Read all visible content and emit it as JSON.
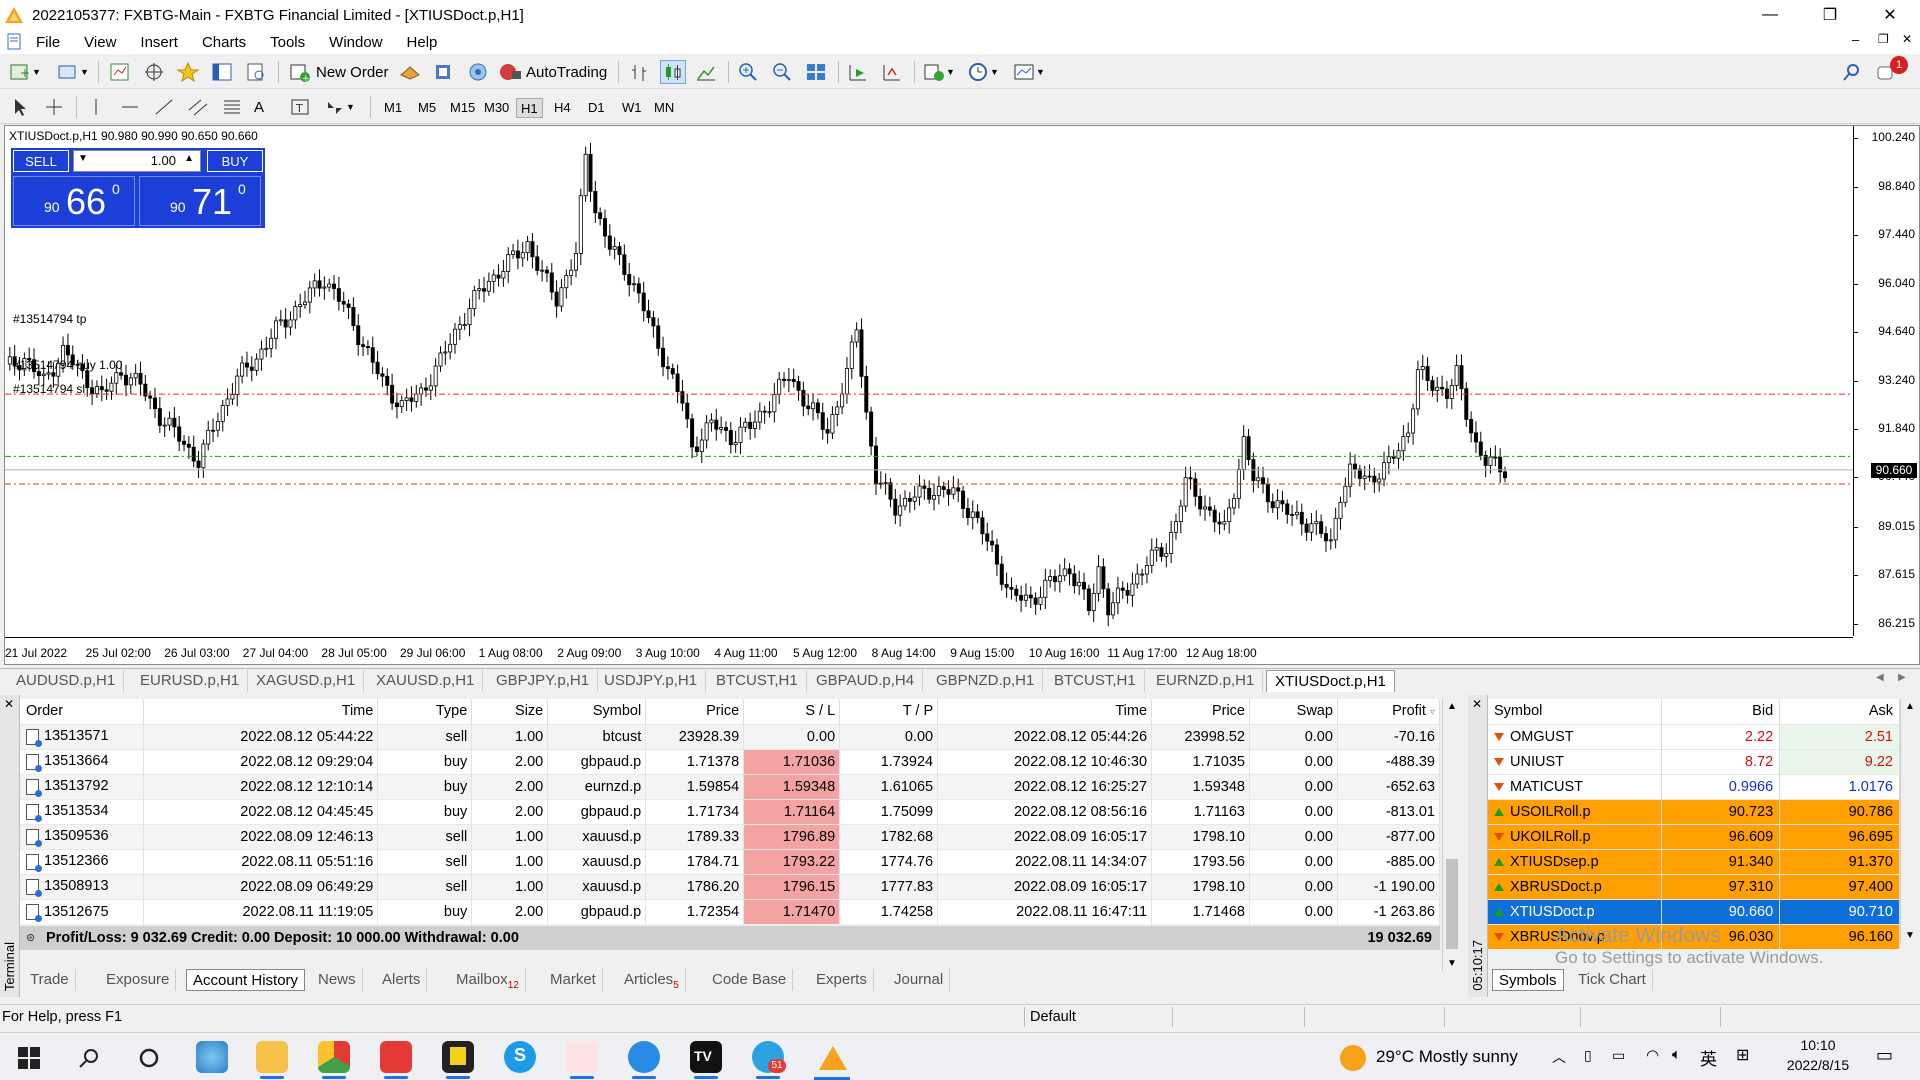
{
  "window": {
    "title": "2022105377: FXBTG-Main - FXBTG Financial Limited - [XTIUSDoct.p,H1]",
    "minimize": "—",
    "maximize": "❐",
    "close": "✕"
  },
  "menu": [
    "File",
    "View",
    "Insert",
    "Charts",
    "Tools",
    "Window",
    "Help"
  ],
  "toolbar": {
    "new_order": "New Order",
    "autotrading": "AutoTrading",
    "notification_count": "1"
  },
  "timeframes": [
    "M1",
    "M5",
    "M15",
    "M30",
    "H1",
    "H4",
    "D1",
    "W1",
    "MN"
  ],
  "active_timeframe": "H1",
  "chart": {
    "caption": "XTIUSDoct.p,H1  90.980 90.990 90.650 90.660",
    "sell_label": "SELL",
    "buy_label": "BUY",
    "volume": "1.00",
    "sell_small": "90",
    "sell_big": "66",
    "sell_sup": "0",
    "buy_small": "90",
    "buy_big": "71",
    "buy_sup": "0",
    "current_price": "90.660",
    "order_labels": [
      "#13514794 tp",
      "#13514794 buy 1.00",
      "#13514794 sl"
    ]
  },
  "chart_data": {
    "type": "candlestick",
    "symbol": "XTIUSDoct.p",
    "timeframe": "H1",
    "y_ticks": [
      "100.240",
      "98.840",
      "97.440",
      "96.040",
      "94.640",
      "93.240",
      "91.840",
      "90.440",
      "89.015",
      "87.615",
      "86.215"
    ],
    "x_ticks": [
      "21 Jul 2022",
      "25 Jul 02:00",
      "26 Jul 03:00",
      "27 Jul 04:00",
      "28 Jul 05:00",
      "29 Jul 06:00",
      "1 Aug 08:00",
      "2 Aug 09:00",
      "3 Aug 10:00",
      "4 Aug 11:00",
      "5 Aug 12:00",
      "8 Aug 14:00",
      "9 Aug 15:00",
      "10 Aug 16:00",
      "11 Aug 17:00",
      "12 Aug 18:00"
    ],
    "ylim": [
      85.8,
      100.6
    ],
    "tp_level": 92.85,
    "entry_level": 91.05,
    "sl_level": 90.25,
    "close_path": [
      [
        0,
        93.6
      ],
      [
        4,
        93.9
      ],
      [
        8,
        93.2
      ],
      [
        12,
        94.1
      ],
      [
        16,
        93.4
      ],
      [
        20,
        92.8
      ],
      [
        24,
        93.5
      ],
      [
        28,
        93.1
      ],
      [
        32,
        92.2
      ],
      [
        36,
        91.6
      ],
      [
        40,
        90.9
      ],
      [
        44,
        92.2
      ],
      [
        48,
        93.3
      ],
      [
        52,
        93.9
      ],
      [
        56,
        94.7
      ],
      [
        60,
        95.3
      ],
      [
        64,
        95.9
      ],
      [
        66,
        96.2
      ],
      [
        70,
        95.4
      ],
      [
        74,
        94.3
      ],
      [
        78,
        93.2
      ],
      [
        82,
        92.5
      ],
      [
        86,
        92.9
      ],
      [
        90,
        93.8
      ],
      [
        94,
        94.9
      ],
      [
        98,
        95.8
      ],
      [
        102,
        96.4
      ],
      [
        106,
        96.9
      ],
      [
        108,
        97.2
      ],
      [
        111,
        96.3
      ],
      [
        114,
        95.6
      ],
      [
        118,
        96.9
      ],
      [
        120,
        99.7
      ],
      [
        122,
        98.2
      ],
      [
        125,
        97.1
      ],
      [
        128,
        96.5
      ],
      [
        131,
        95.7
      ],
      [
        134,
        94.6
      ],
      [
        137,
        93.6
      ],
      [
        140,
        92.6
      ],
      [
        142,
        91.3
      ],
      [
        146,
        92.0
      ],
      [
        150,
        91.6
      ],
      [
        154,
        91.9
      ],
      [
        158,
        92.6
      ],
      [
        162,
        93.4
      ],
      [
        166,
        92.5
      ],
      [
        170,
        91.8
      ],
      [
        174,
        93.4
      ],
      [
        176,
        94.8
      ],
      [
        178,
        92.3
      ],
      [
        180,
        90.4
      ],
      [
        184,
        89.6
      ],
      [
        188,
        89.9
      ],
      [
        192,
        90.1
      ],
      [
        196,
        90.0
      ],
      [
        200,
        89.4
      ],
      [
        204,
        88.3
      ],
      [
        208,
        87.0
      ],
      [
        212,
        86.9
      ],
      [
        216,
        87.4
      ],
      [
        220,
        87.8
      ],
      [
        222,
        87.3
      ],
      [
        224,
        86.6
      ],
      [
        226,
        87.8
      ],
      [
        228,
        86.7
      ],
      [
        232,
        87.2
      ],
      [
        236,
        88.0
      ],
      [
        240,
        88.4
      ],
      [
        242,
        89.2
      ],
      [
        244,
        90.3
      ],
      [
        248,
        89.6
      ],
      [
        252,
        88.9
      ],
      [
        254,
        90.1
      ],
      [
        256,
        91.5
      ],
      [
        258,
        90.4
      ],
      [
        262,
        89.8
      ],
      [
        266,
        89.3
      ],
      [
        270,
        89.1
      ],
      [
        274,
        88.5
      ],
      [
        276,
        90.0
      ],
      [
        278,
        90.6
      ],
      [
        282,
        90.4
      ],
      [
        286,
        90.8
      ],
      [
        290,
        91.8
      ],
      [
        292,
        93.5
      ],
      [
        294,
        93.2
      ],
      [
        298,
        92.9
      ],
      [
        300,
        93.4
      ],
      [
        302,
        92.3
      ],
      [
        304,
        91.4
      ],
      [
        306,
        90.9
      ],
      [
        310,
        90.66
      ]
    ]
  },
  "chart_tabs": [
    "AUDUSD.p,H1",
    "EURUSD.p,H1",
    "XAGUSD.p,H1",
    "XAUUSD.p,H1",
    "GBPJPY.p,H1",
    "USDJPY.p,H1",
    "BTCUST,H1",
    "GBPAUD.p,H4",
    "GBPNZD.p,H1",
    "BTCUST,H1",
    "EURNZD.p,H1",
    "XTIUSDoct.p,H1"
  ],
  "history": {
    "columns": [
      "Order",
      "Time",
      "Type",
      "Size",
      "Symbol",
      "Price",
      "S / L",
      "T / P",
      "Time",
      "Price",
      "Swap",
      "Profit"
    ],
    "rows": [
      {
        "order": "13513571",
        "time": "2022.08.12 05:44:22",
        "type": "sell",
        "size": "1.00",
        "symbol": "btcust",
        "price": "23928.39",
        "sl": "0.00",
        "tp": "0.00",
        "ctime": "2022.08.12 05:44:26",
        "cprice": "23998.52",
        "swap": "0.00",
        "profit": "-70.16",
        "sl_hit": false
      },
      {
        "order": "13513664",
        "time": "2022.08.12 09:29:04",
        "type": "buy",
        "size": "2.00",
        "symbol": "gbpaud.p",
        "price": "1.71378",
        "sl": "1.71036",
        "tp": "1.73924",
        "ctime": "2022.08.12 10:46:30",
        "cprice": "1.71035",
        "swap": "0.00",
        "profit": "-488.39",
        "sl_hit": true
      },
      {
        "order": "13513792",
        "time": "2022.08.12 12:10:14",
        "type": "buy",
        "size": "2.00",
        "symbol": "eurnzd.p",
        "price": "1.59854",
        "sl": "1.59348",
        "tp": "1.61065",
        "ctime": "2022.08.12 16:25:27",
        "cprice": "1.59348",
        "swap": "0.00",
        "profit": "-652.63",
        "sl_hit": true
      },
      {
        "order": "13513534",
        "time": "2022.08.12 04:45:45",
        "type": "buy",
        "size": "2.00",
        "symbol": "gbpaud.p",
        "price": "1.71734",
        "sl": "1.71164",
        "tp": "1.75099",
        "ctime": "2022.08.12 08:56:16",
        "cprice": "1.71163",
        "swap": "0.00",
        "profit": "-813.01",
        "sl_hit": true
      },
      {
        "order": "13509536",
        "time": "2022.08.09 12:46:13",
        "type": "sell",
        "size": "1.00",
        "symbol": "xauusd.p",
        "price": "1789.33",
        "sl": "1796.89",
        "tp": "1782.68",
        "ctime": "2022.08.09 16:05:17",
        "cprice": "1798.10",
        "swap": "0.00",
        "profit": "-877.00",
        "sl_hit": true
      },
      {
        "order": "13512366",
        "time": "2022.08.11 05:51:16",
        "type": "sell",
        "size": "1.00",
        "symbol": "xauusd.p",
        "price": "1784.71",
        "sl": "1793.22",
        "tp": "1774.76",
        "ctime": "2022.08.11 14:34:07",
        "cprice": "1793.56",
        "swap": "0.00",
        "profit": "-885.00",
        "sl_hit": true
      },
      {
        "order": "13508913",
        "time": "2022.08.09 06:49:29",
        "type": "sell",
        "size": "1.00",
        "symbol": "xauusd.p",
        "price": "1786.20",
        "sl": "1796.15",
        "tp": "1777.83",
        "ctime": "2022.08.09 16:05:17",
        "cprice": "1798.10",
        "swap": "0.00",
        "profit": "-1 190.00",
        "sl_hit": true
      },
      {
        "order": "13512675",
        "time": "2022.08.11 11:19:05",
        "type": "buy",
        "size": "2.00",
        "symbol": "gbpaud.p",
        "price": "1.72354",
        "sl": "1.71470",
        "tp": "1.74258",
        "ctime": "2022.08.11 16:47:11",
        "cprice": "1.71468",
        "swap": "0.00",
        "profit": "-1 263.86",
        "sl_hit": true
      }
    ],
    "summary": "Profit/Loss: 9 032.69  Credit: 0.00  Deposit: 10 000.00  Withdrawal: 0.00",
    "summary_total": "19 032.69"
  },
  "terminal": {
    "side_label": "Terminal",
    "tabs": [
      {
        "label": "Trade",
        "badge": ""
      },
      {
        "label": "Exposure",
        "badge": ""
      },
      {
        "label": "Account History",
        "badge": ""
      },
      {
        "label": "News",
        "badge": ""
      },
      {
        "label": "Alerts",
        "badge": ""
      },
      {
        "label": "Mailbox",
        "badge": "12"
      },
      {
        "label": "Market",
        "badge": ""
      },
      {
        "label": "Articles",
        "badge": "5"
      },
      {
        "label": "Code Base",
        "badge": ""
      },
      {
        "label": "Experts",
        "badge": ""
      },
      {
        "label": "Journal",
        "badge": ""
      }
    ],
    "active_tab": "Account History"
  },
  "market_watch": {
    "side_label": "05:10:17",
    "columns": [
      "Symbol",
      "Bid",
      "Ask"
    ],
    "rows": [
      {
        "symbol": "OMGUST",
        "bid": "2.22",
        "ask": "2.51",
        "dir": "down",
        "style": "red"
      },
      {
        "symbol": "UNIUST",
        "bid": "8.72",
        "ask": "9.22",
        "dir": "down",
        "style": "red"
      },
      {
        "symbol": "MATICUST",
        "bid": "0.9966",
        "ask": "1.0176",
        "dir": "down",
        "style": "blue"
      },
      {
        "symbol": "USOILRoll.p",
        "bid": "90.723",
        "ask": "90.786",
        "dir": "up",
        "style": "orange"
      },
      {
        "symbol": "UKOILRoll.p",
        "bid": "96.609",
        "ask": "96.695",
        "dir": "down",
        "style": "orange"
      },
      {
        "symbol": "XTIUSDsep.p",
        "bid": "91.340",
        "ask": "91.370",
        "dir": "up",
        "style": "orange"
      },
      {
        "symbol": "XBRUSDoct.p",
        "bid": "97.310",
        "ask": "97.400",
        "dir": "up",
        "style": "orange"
      },
      {
        "symbol": "XTIUSDoct.p",
        "bid": "90.660",
        "ask": "90.710",
        "dir": "up",
        "style": "selected"
      },
      {
        "symbol": "XBRUSDnov.p",
        "bid": "96.030",
        "ask": "96.160",
        "dir": "down",
        "style": "orange"
      }
    ],
    "tabs": [
      "Symbols",
      "Tick Chart"
    ]
  },
  "statusbar": {
    "help": "For Help, press F1",
    "profile": "Default"
  },
  "watermark": {
    "line1": "Activate Windows",
    "line2": "Go to Settings to activate Windows."
  },
  "taskbar": {
    "weather": "29°C  Mostly sunny",
    "ime": "英",
    "time": "10:10",
    "date": "2022/8/15",
    "telegram_badge": "51"
  },
  "colors": {
    "sl_red": "#f4a3a3",
    "orange_row": "#ff9f00",
    "selected_row": "#0f6fd8",
    "oneclick_blue": "#1c3fd8",
    "candle": "#000000",
    "tp_sl_line": "#e0301e",
    "entry_line": "#1a9e1a"
  }
}
